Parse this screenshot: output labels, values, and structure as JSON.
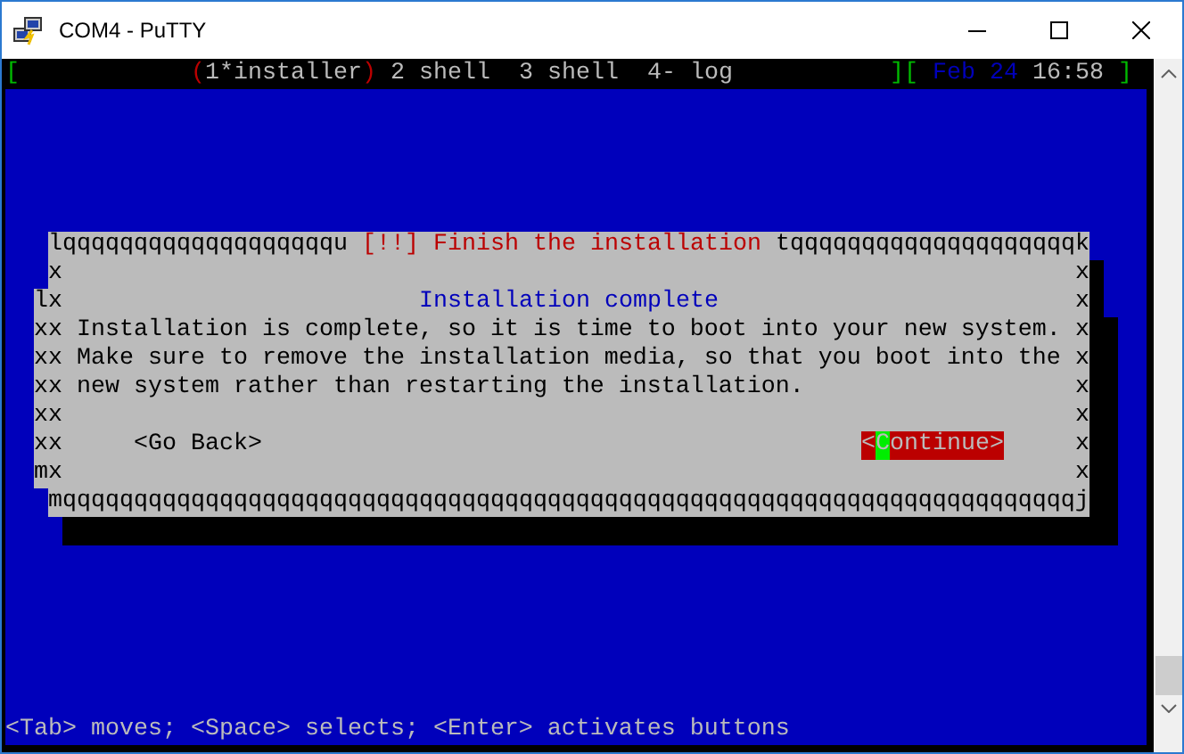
{
  "window": {
    "title": "COM4 - PuTTY"
  },
  "tmux_bar": {
    "left_bracket": "[",
    "active_markers": [
      "(",
      ")"
    ],
    "windows": [
      {
        "label": "1*installer",
        "selected": true
      },
      {
        "label": "2 shell",
        "selected": false
      },
      {
        "label": "3 shell",
        "selected": false
      },
      {
        "label": "4- log",
        "selected": false
      }
    ],
    "right_brackets": "][",
    "date": "Feb 24",
    "time": "16:58",
    "end_bracket": "]"
  },
  "dialog": {
    "top_left": "lqqqqqqqqqqqqqqqqqqqu",
    "title": "[!!] Finish the installation",
    "top_right": "tqqqqqqqqqqqqqqqqqqqqk",
    "left_edge": [
      "x",
      "lx",
      "xx",
      "xx",
      "xx",
      "xx",
      "xx",
      "mx"
    ],
    "right_edge": [
      "x",
      "x",
      "x",
      "x",
      "x",
      "x",
      "x",
      "x"
    ],
    "heading": "Installation complete",
    "message": "Installation is complete, so it is time to boot into your new system. Make sure to remove the installation media, so that you boot into the new system rather than restarting the installation.",
    "buttons": [
      {
        "label": "<Go Back>",
        "selected": false
      },
      {
        "label": "<Continue>",
        "selected": true
      }
    ],
    "bottom": "mqqqqqqqqqqqqqqqqqqqqqqqqqqqqqqqqqqqqqqqqqqqqqqqqqqqqqqqqqqqqqqqqqqqqqqqj"
  },
  "hint": "<Tab> moves; <Space> selects; <Enter> activates buttons"
}
